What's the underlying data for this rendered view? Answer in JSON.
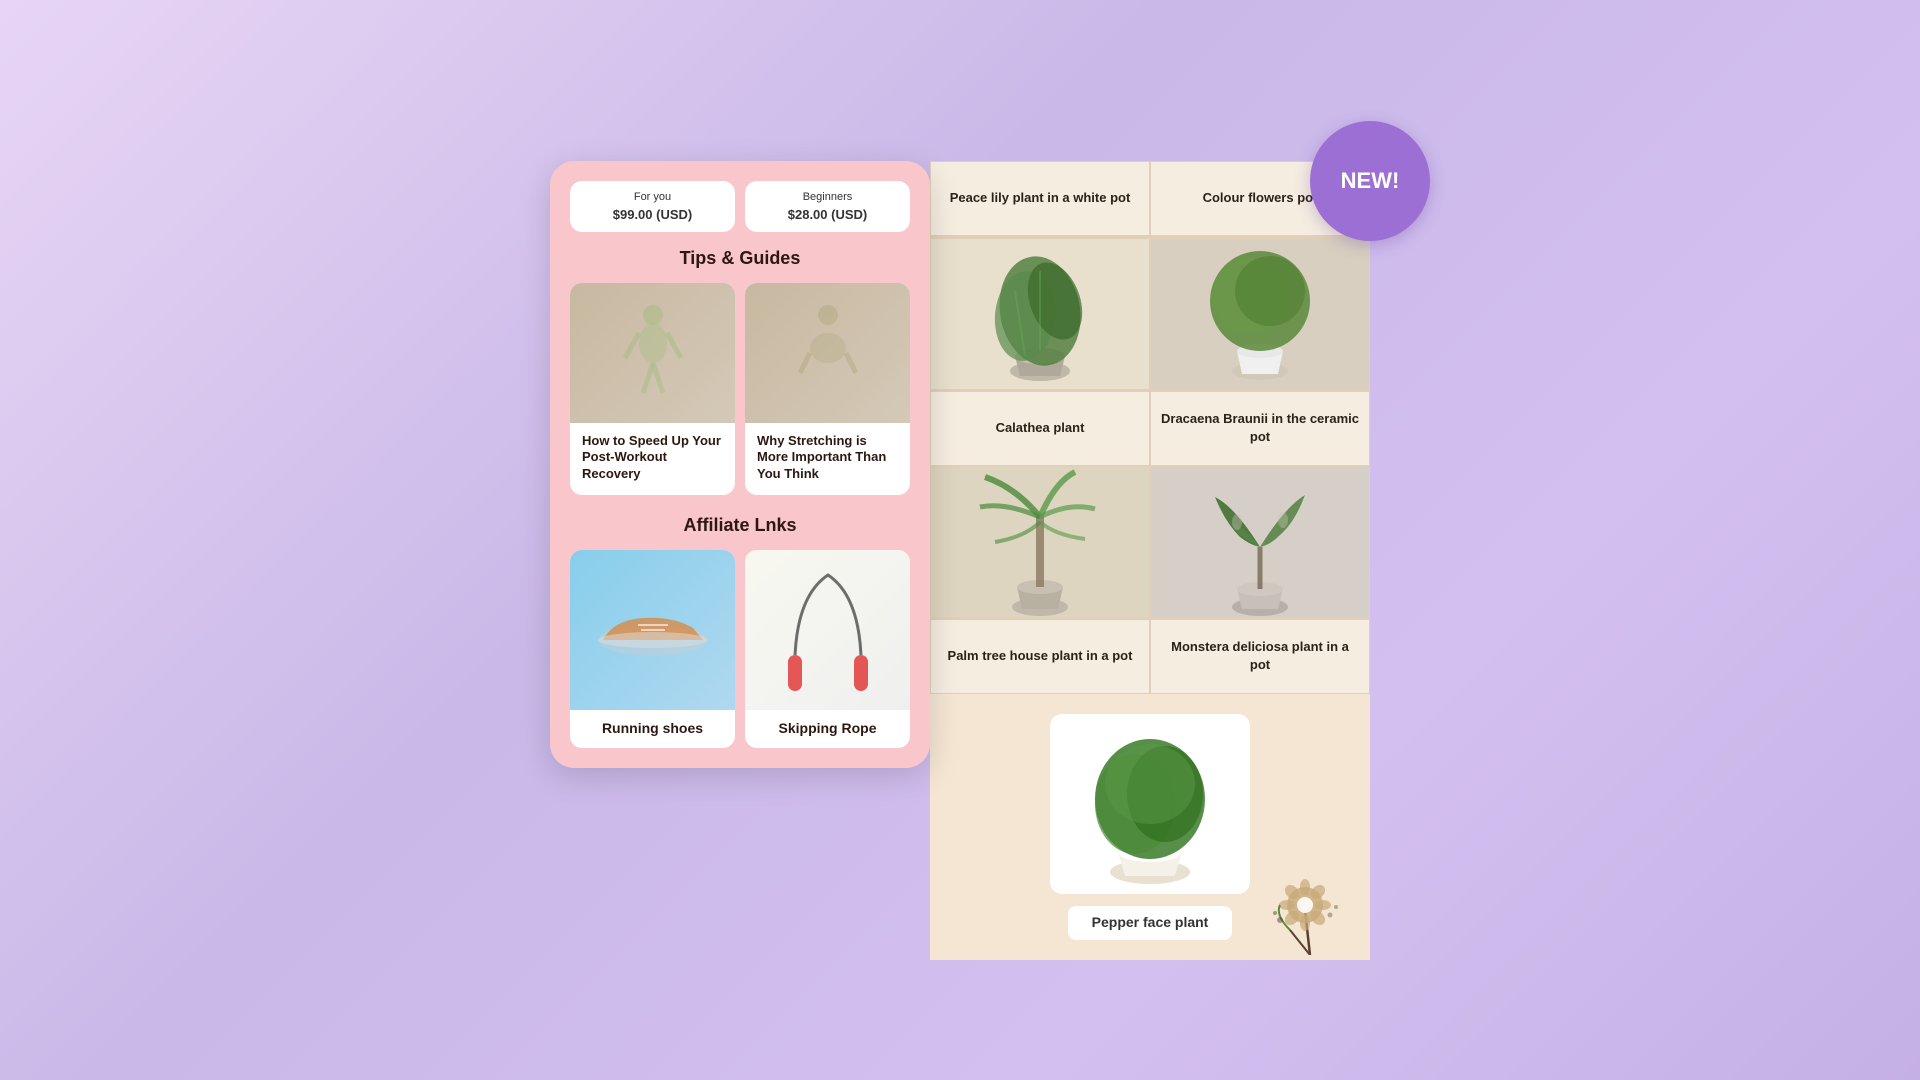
{
  "page": {
    "background": "lavender gradient",
    "new_badge": "NEW!"
  },
  "left_panel": {
    "price_cards": [
      {
        "title": "For you",
        "price": "$99.00 (USD)"
      },
      {
        "title": "Beginners",
        "price": "$28.00 (USD)"
      }
    ],
    "tips_section": {
      "title": "Tips & Guides",
      "cards": [
        {
          "label": "How to Speed Up Your Post-Workout Recovery",
          "image_desc": "woman sitting on yoga mat"
        },
        {
          "label": "Why Stretching is More Important Than You Think",
          "image_desc": "woman stretching on floor"
        }
      ]
    },
    "affiliate_section": {
      "title": "Affiliate Lnks",
      "cards": [
        {
          "label": "Running shoes",
          "image_desc": "person wearing orange running shoes"
        },
        {
          "label": "Skipping Rope",
          "image_desc": "red skipping rope"
        }
      ]
    }
  },
  "right_panel": {
    "plants": [
      {
        "name": "Peace lily plant in a white pot",
        "position": "top-left"
      },
      {
        "name": "Colour flowers pot",
        "position": "top-right"
      },
      {
        "name": "Calathea plant",
        "position": "mid-left-name"
      },
      {
        "name": "Dracaena Braunii in the ceramic pot",
        "position": "mid-right-name"
      },
      {
        "name": "Palm tree house plant in a pot",
        "position": "bot-left-name"
      },
      {
        "name": "Monstera deliciosa plant in a pot",
        "position": "bot-right-name"
      },
      {
        "name": "Pepper face plant",
        "position": "bottom"
      }
    ]
  }
}
